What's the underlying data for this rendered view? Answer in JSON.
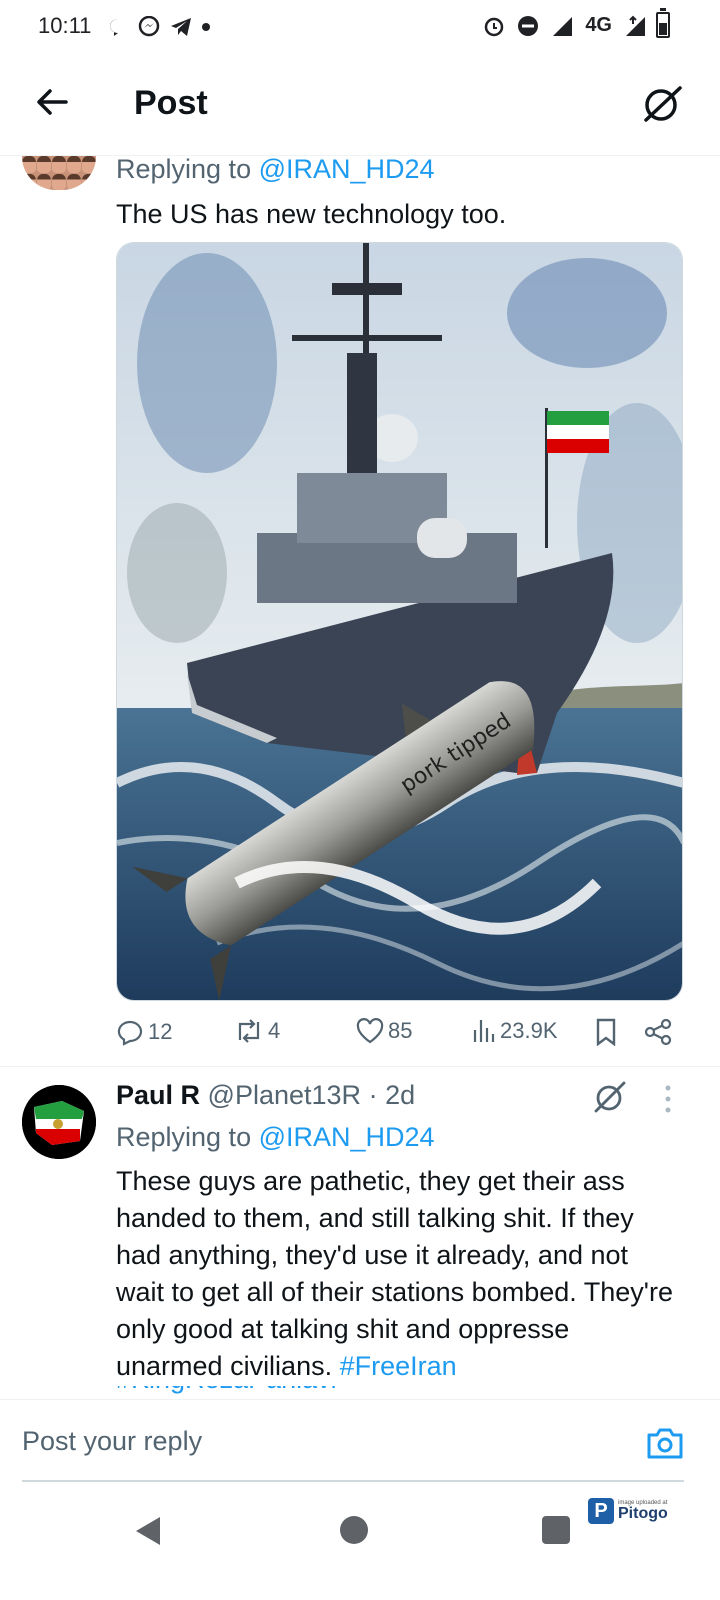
{
  "status_bar": {
    "time": "10:11",
    "network": "4G",
    "left_icons": [
      "chat-bubble-icon",
      "messenger-icon",
      "telegram-icon",
      "dot-icon"
    ],
    "right_icons": [
      "alarm-icon",
      "dnd-icon",
      "signal-icon",
      "wifi-icon",
      "battery-icon"
    ]
  },
  "header": {
    "title": "Post",
    "back_icon": "arrow-left-icon",
    "grok_icon": "grok-icon"
  },
  "tweet1": {
    "replying_prefix": "Replying to",
    "replying_handle": "@IRAN_HD24",
    "text": "The US has new technology too.",
    "image_text": "pork tipped",
    "stats": {
      "replies": "12",
      "reposts": "4",
      "likes": "85",
      "views": "23.9K"
    }
  },
  "tweet2": {
    "name": "Paul R",
    "handle": "@Planet13R",
    "separator": "·",
    "time": "2d",
    "replying_prefix": "Replying to",
    "replying_handle": "@IRAN_HD24",
    "body": "These guys are pathetic, they get their ass handed to them, and still talking shit. If they had anything, they'd use it already, and not wait to get all of their stations bombed. They're only good at talking shit and oppresse unarmed civilians. ",
    "hashtag1": "#FreeIran",
    "hashtag2_clipped": "#KingRezaPahlavi"
  },
  "composer": {
    "placeholder": "Post your reply"
  },
  "watermark": {
    "small": "image uploaded at",
    "name": "Pitogo",
    "badge": "P"
  },
  "colors": {
    "accent": "#1d9bf0",
    "muted": "#536471",
    "text": "#0f1419"
  }
}
